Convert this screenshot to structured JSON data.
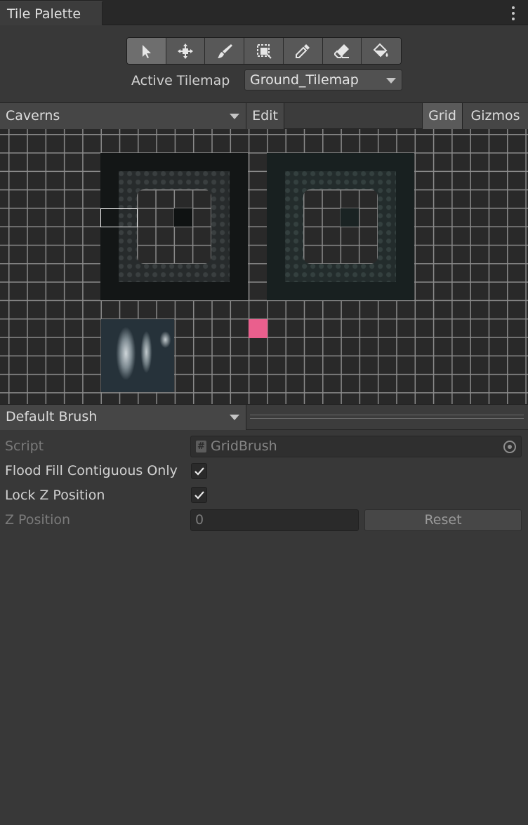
{
  "window": {
    "tab_title": "Tile Palette"
  },
  "tools": [
    {
      "name": "select-tool",
      "icon": "arrow-icon",
      "active": true
    },
    {
      "name": "move-tool",
      "icon": "move-icon",
      "active": false
    },
    {
      "name": "paint-tool",
      "icon": "brush-icon",
      "active": false
    },
    {
      "name": "box-fill-tool",
      "icon": "box-fill-icon",
      "active": false
    },
    {
      "name": "picker-tool",
      "icon": "eyedropper-icon",
      "active": false
    },
    {
      "name": "erase-tool",
      "icon": "eraser-icon",
      "active": false
    },
    {
      "name": "fill-tool",
      "icon": "paint-bucket-icon",
      "active": false
    }
  ],
  "active_tilemap": {
    "label": "Active Tilemap",
    "value": "Ground_Tilemap"
  },
  "palette_bar": {
    "palette": "Caverns",
    "edit": "Edit",
    "grid": "Grid",
    "gizmos": "Gizmos"
  },
  "brush_bar": {
    "brush": "Default Brush"
  },
  "properties": {
    "script_label": "Script",
    "script_value": "GridBrush",
    "flood_fill_label": "Flood Fill Contiguous Only",
    "flood_fill_checked": true,
    "lock_z_label": "Lock Z Position",
    "lock_z_checked": true,
    "z_position_label": "Z Position",
    "z_position_value": "0",
    "reset_label": "Reset"
  },
  "colors": {
    "accent_tile": "#ea5f8d",
    "background": "#383838"
  }
}
